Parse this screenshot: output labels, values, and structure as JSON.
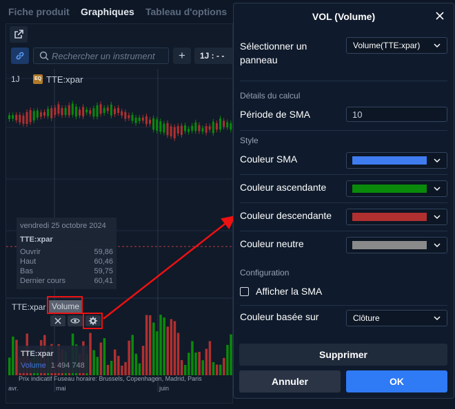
{
  "tabs": [
    {
      "label": "Fiche produit",
      "active": false
    },
    {
      "label": "Graphiques",
      "active": true
    },
    {
      "label": "Tableau d'options",
      "active": false
    }
  ],
  "toolbar": {
    "search_placeholder": "Rechercher un instrument",
    "add_label": "+",
    "interval_label": "1J : - -"
  },
  "chart": {
    "interval": "1J",
    "badge": "EQ",
    "symbol": "TTE:xpar",
    "info": {
      "date": "vendredi 25 octobre 2024",
      "symbol": "TTE:xpar",
      "rows": [
        {
          "label": "Ouvrir",
          "value": "59,86"
        },
        {
          "label": "Haut",
          "value": "60,46"
        },
        {
          "label": "Bas",
          "value": "59,75"
        },
        {
          "label": "Dernier cours",
          "value": "60,41"
        }
      ]
    },
    "volume_pane": {
      "symbol": "TTE:xpar",
      "indicator": "Volume",
      "legend_symbol": "TTE:xpar",
      "legend_label": "Volume",
      "legend_value": "1 494 748"
    },
    "footer_text": "Prix indicatif   Fuseau horaire: Brussels, Copenhagen, Madrid, Paris",
    "months": [
      "avr.",
      "mai",
      "juin"
    ]
  },
  "dialog": {
    "title": "VOL (Volume)",
    "panel_label": "Sélectionner un panneau",
    "panel_value": "Volume(TTE:xpar)",
    "section_calc": "Détails du calcul",
    "sma_period_label": "Période de SMA",
    "sma_period_value": "10",
    "section_style": "Style",
    "sma_color_label": "Couleur SMA",
    "up_color_label": "Couleur ascendante",
    "down_color_label": "Couleur descendante",
    "neutral_color_label": "Couleur neutre",
    "section_config": "Configuration",
    "show_sma_label": "Afficher la SMA",
    "show_sma_checked": false,
    "based_on_label": "Couleur basée sur",
    "based_on_value": "Clôture",
    "delete_label": "Supprimer",
    "cancel_label": "Annuler",
    "ok_label": "OK"
  },
  "colors": {
    "sma": "#3f7cf0",
    "ascending": "#0a8a0a",
    "descending": "#b03030",
    "neutral": "#8a8a8a",
    "accent": "#2f7af5",
    "annotation": "#ee1111"
  },
  "icons": [
    "external-link-icon",
    "link-icon",
    "search-icon",
    "close-icon",
    "eye-icon",
    "gear-icon",
    "chevron-down-icon"
  ]
}
